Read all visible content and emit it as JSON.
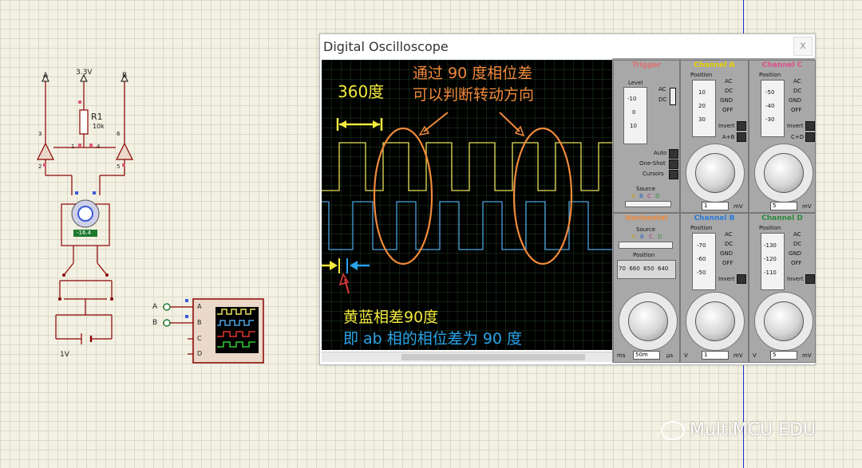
{
  "schematic": {
    "net_a": "A",
    "net_b": "B",
    "vcc": "3.3V",
    "r1_name": "R1",
    "r1_value": "10k",
    "pin3": "3",
    "pin2": "2",
    "pin1": "1",
    "pin4": "4",
    "pin6": "6",
    "pin5": "5",
    "motor_readout": "-16.4",
    "battery_label": "1V",
    "scope_inputs": [
      "A",
      "B",
      "C",
      "D"
    ]
  },
  "oscilloscope": {
    "title": "Digital Oscilloscope",
    "close": "x",
    "trigger": {
      "title": "Trigger",
      "level": "Level",
      "ac": "AC",
      "dc": "DC",
      "level_ticks": [
        "-10",
        "0",
        "10"
      ],
      "modes": [
        "Auto",
        "One-Shot",
        "Cursors"
      ],
      "source": "Source",
      "source_opts": [
        "A",
        "B",
        "C",
        "D"
      ]
    },
    "channel_a": {
      "title": "Channel A",
      "position": "Position",
      "pos_ticks": [
        "10",
        "20",
        "30"
      ],
      "coupling": [
        "AC",
        "DC",
        "GND",
        "OFF"
      ],
      "invert": "Invert",
      "sum": "A+B",
      "value": "1",
      "unit": "mV"
    },
    "channel_c": {
      "title": "Channel C",
      "position": "Position",
      "pos_ticks": [
        "-50",
        "-40",
        "-30"
      ],
      "coupling": [
        "AC",
        "DC",
        "GND",
        "OFF"
      ],
      "invert": "Invert",
      "sum": "C+D",
      "value": "5",
      "unit": "mV"
    },
    "horizontal": {
      "title": "Horizontal",
      "source": "Source",
      "source_opts": [
        "A",
        "B",
        "C",
        "D"
      ],
      "position": "Position",
      "scale": "70  660  650  640",
      "left_unit": "ms",
      "value": "50m",
      "unit": "µs"
    },
    "channel_b": {
      "title": "Channel B",
      "position": "Position",
      "pos_ticks": [
        "-70",
        "-60",
        "-50"
      ],
      "coupling": [
        "AC",
        "DC",
        "GND",
        "OFF"
      ],
      "invert": "Invert",
      "value": "1",
      "unit": "mV"
    },
    "channel_d": {
      "title": "Channel D",
      "position": "Position",
      "pos_ticks": [
        "-130",
        "-120",
        "-110"
      ],
      "coupling": [
        "AC",
        "DC",
        "GND",
        "OFF"
      ],
      "invert": "Invert",
      "value": "5",
      "unit": "mV"
    }
  },
  "annotations": {
    "period": "360度",
    "phase_title_1": "通过 90 度相位差",
    "phase_title_2": "可以判断转动方向",
    "note_1": "黄蓝相差90度",
    "note_2": "即 ab 相的相位差为 90 度"
  },
  "watermark": "MultiMCU EDU",
  "colors": {
    "trace_a": "#e8e25a",
    "trace_b": "#4aa3df",
    "annot_orange": "#f08a3c",
    "annot_yellow": "#f2ea3c",
    "annot_blue": "#2aa4ea",
    "annot_red": "#e23a3a"
  }
}
